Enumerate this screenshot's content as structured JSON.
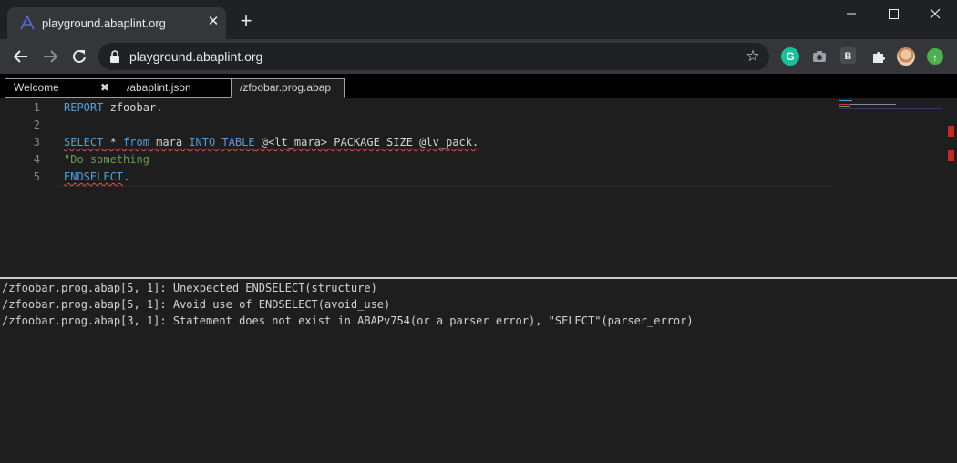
{
  "browser": {
    "tab_title": "playground.abaplint.org",
    "url": "playground.abaplint.org",
    "icons": [
      "abaplint-favicon",
      "close-icon",
      "plus-icon",
      "minimize-icon",
      "maximize-icon",
      "window-close-icon",
      "back-icon",
      "forward-icon",
      "reload-icon",
      "lock-icon",
      "star-icon"
    ],
    "extensions": {
      "grammarly": "G",
      "b_ext": "B",
      "update": "↑"
    }
  },
  "editor": {
    "tabs": [
      {
        "label": "Welcome",
        "close": "✖"
      },
      {
        "label": "/abaplint.json"
      },
      {
        "label": "/zfoobar.prog.abap"
      }
    ],
    "line_numbers": [
      "1",
      "2",
      "3",
      "4",
      "5"
    ],
    "lines": {
      "l1_kw": "REPORT",
      "l1_rest": " zfoobar.",
      "l3_select": "SELECT",
      "l3_a": " * ",
      "l3_from": "from",
      "l3_b": " mara ",
      "l3_into": "INTO TABLE",
      "l3_c": " @<lt_mara> PACKAGE SIZE @lv_pack.",
      "l4_comment": "\"Do something",
      "l5_kw": "ENDSELECT",
      "l5_dot": "."
    }
  },
  "problems": [
    "/zfoobar.prog.abap[5, 1]: Unexpected ENDSELECT(structure)",
    "/zfoobar.prog.abap[5, 1]: Avoid use of ENDSELECT(avoid_use)",
    "/zfoobar.prog.abap[3, 1]: Statement does not exist in ABAPv754(or a parser error), \"SELECT\"(parser_error)"
  ],
  "colors": {
    "keyword": "#569cd6",
    "comment": "#6a9955",
    "error": "#f14c4c"
  }
}
